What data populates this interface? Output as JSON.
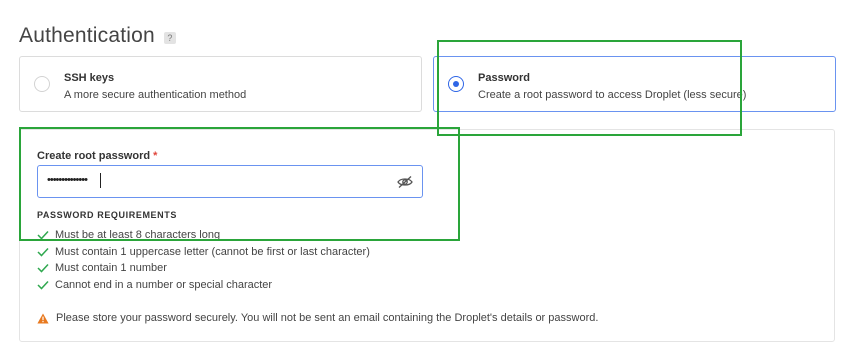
{
  "section": {
    "title": "Authentication",
    "help_badge": "?"
  },
  "options": [
    {
      "title": "SSH keys",
      "description": "A more secure authentication method",
      "selected": false
    },
    {
      "title": "Password",
      "description": "Create a root password to access Droplet (less secure)",
      "selected": true
    }
  ],
  "password_field": {
    "label": "Create root password",
    "required_marker": "*",
    "masked_value": "••••••••••••••",
    "toggle_icon": "eye-slash-icon"
  },
  "requirements": {
    "heading": "PASSWORD REQUIREMENTS",
    "items": [
      "Must be at least 8 characters long",
      "Must contain 1 uppercase letter (cannot be first or last character)",
      "Must contain 1 number",
      "Cannot end in a number or special character"
    ],
    "status_icon": "check-icon"
  },
  "warning": {
    "icon": "warning-icon",
    "text": "Please store your password securely. You will not be sent an email containing the Droplet's details or password."
  },
  "colors": {
    "accent": "#2f66e6",
    "check": "#2fa84f",
    "warning": "#e8791f",
    "required": "#e0463c",
    "highlight": "#2aa53a"
  }
}
